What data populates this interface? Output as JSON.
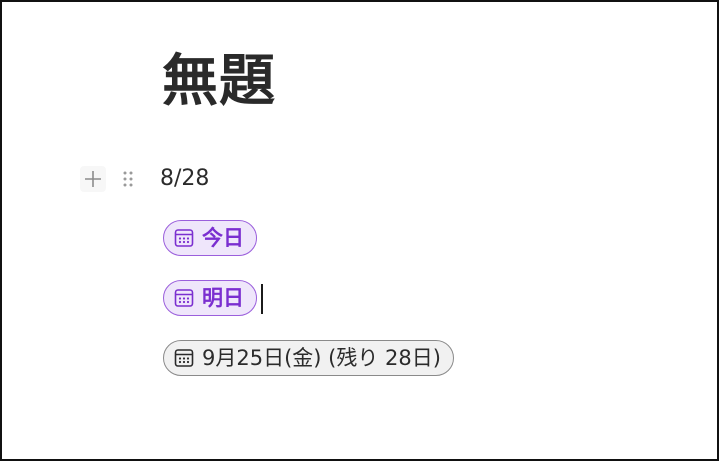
{
  "document": {
    "title": "無題",
    "first_line": "8/28"
  },
  "chips": [
    {
      "label": "今日",
      "style": "purple",
      "icon": "calendar-icon"
    },
    {
      "label": "明日",
      "style": "purple",
      "icon": "calendar-icon"
    },
    {
      "label": "9月25日(金) (残り 28日)",
      "style": "gray",
      "icon": "calendar-icon"
    }
  ],
  "icons": {
    "add_block": "plus-icon",
    "drag_handle": "drag-handle-icon"
  },
  "colors": {
    "accent_text": "#7b2fd0",
    "accent_bg": "#efe6fb",
    "accent_border": "#9b5fdc",
    "neutral_bg": "#f1f1f1"
  }
}
